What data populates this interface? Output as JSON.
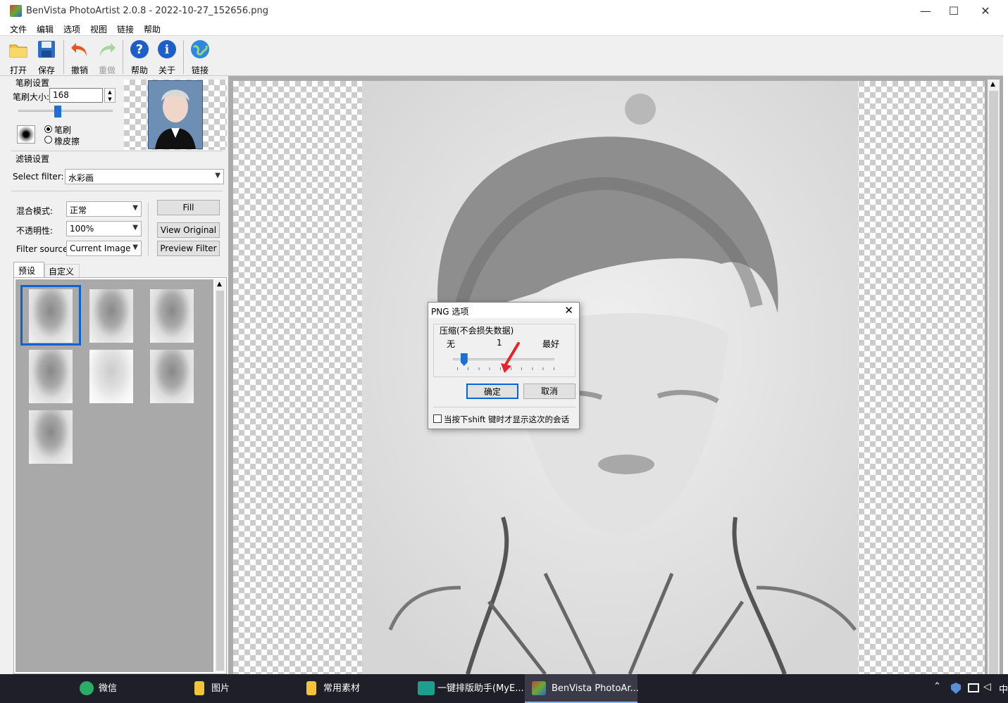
{
  "window": {
    "title": "BenVista PhotoArtist 2.0.8 - 2022-10-27_152656.png",
    "controls": {
      "minimize": "—",
      "maximize": "☐",
      "close": "✕"
    }
  },
  "menu": [
    "文件",
    "编辑",
    "选项",
    "视图",
    "链接",
    "帮助"
  ],
  "toolbar": {
    "open": "打开",
    "save": "保存",
    "undo": "撤销",
    "redo": "重做",
    "help": "帮助",
    "about": "关于",
    "link": "链接"
  },
  "brush": {
    "group_label": "笔刷设置",
    "size_label": "笔刷大小:",
    "size_value": "168",
    "size_slider_fraction": 0.42,
    "mode_brush": "笔刷",
    "mode_eraser": "橡皮擦",
    "selected_mode": "brush"
  },
  "filter": {
    "group_label": "滤镜设置",
    "select_label": "Select filter:",
    "select_value": "水彩画",
    "blend_label": "混合模式:",
    "blend_value": "正常",
    "opacity_label": "不透明性:",
    "opacity_value": "100%",
    "source_label": "Filter source:",
    "source_value": "Current Image",
    "fill_button": "Fill",
    "view_original_button": "View Original",
    "preview_filter_button": "Preview Filter",
    "tabs": [
      "预设",
      "自定义"
    ],
    "active_tab": "预设",
    "preset_count": 7,
    "selected_preset": 0
  },
  "dialog": {
    "title": "PNG 选项",
    "close": "✕",
    "group_label": "压缩(不会损失数据)",
    "min_label": "无",
    "value_label": "1",
    "max_label": "最好",
    "slider_fraction": 0.11,
    "ok_button": "确定",
    "cancel_button": "取消",
    "checkbox_label": "当按下shift 键时才显示这次的会话",
    "checkbox_checked": false
  },
  "taskbar": {
    "items": [
      {
        "label": "微信"
      },
      {
        "label": "图片"
      },
      {
        "label": "常用素材"
      },
      {
        "label": "一键排版助手(MyE..."
      },
      {
        "label": "BenVista PhotoAr..."
      }
    ],
    "tray_lang": "中"
  },
  "colors": {
    "accent": "#0a64d0",
    "taskbar": "#1f1f2a",
    "dialog_slider": "#1b70d1",
    "arrow_annotation": "#e8222a"
  }
}
